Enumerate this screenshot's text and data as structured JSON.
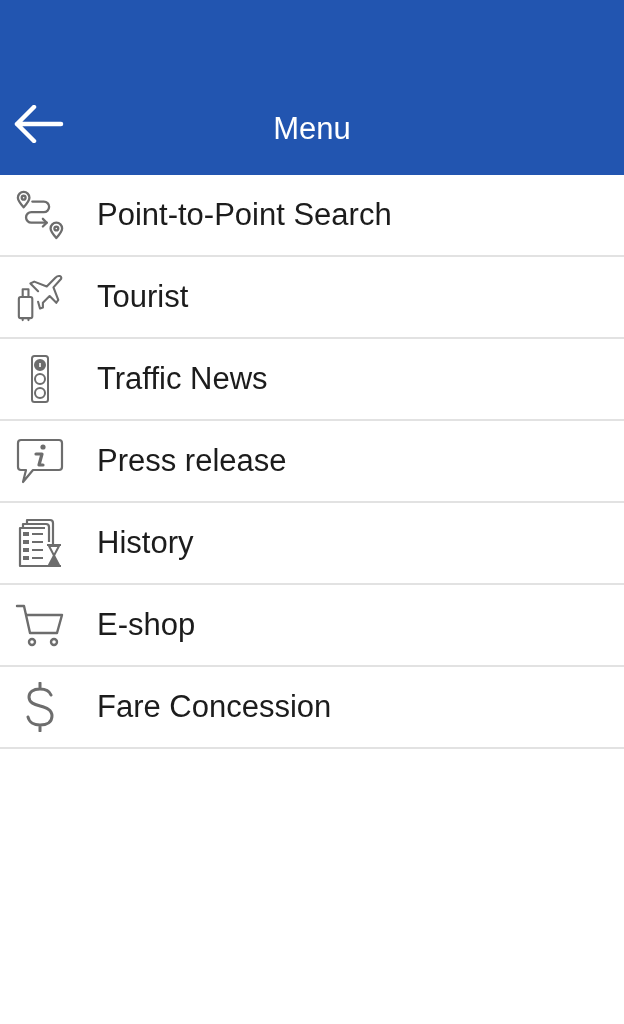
{
  "header": {
    "title": "Menu"
  },
  "menu_items": [
    {
      "label": "Point-to-Point Search",
      "kind": "route"
    },
    {
      "label": "Tourist",
      "kind": "tourist"
    },
    {
      "label": "Traffic News",
      "kind": "traffic"
    },
    {
      "label": "Press release",
      "kind": "info"
    },
    {
      "label": "History",
      "kind": "history"
    },
    {
      "label": "E-shop",
      "kind": "cart"
    },
    {
      "label": "Fare Concession",
      "kind": "fare"
    }
  ]
}
